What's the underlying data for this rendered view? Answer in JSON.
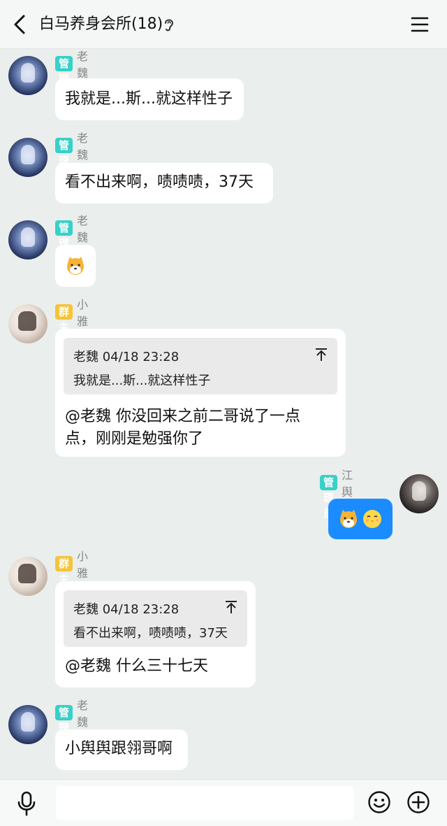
{
  "header": {
    "title": "白马养身会所(18)",
    "back_icon": "chevron-left-icon",
    "ear_icon": "ear-icon",
    "menu_icon": "menu-icon"
  },
  "badges": {
    "admin": "管理员",
    "owner": "群主"
  },
  "messages": [
    {
      "sender": "老魏",
      "role": "admin",
      "text": "我就是...斯...就这样性子"
    },
    {
      "sender": "老魏",
      "role": "admin",
      "text": "看不出来啊，啧啧啧，37天"
    },
    {
      "sender": "老魏",
      "role": "admin",
      "emoji": "shiba-dog-emoji"
    },
    {
      "sender": "小雅",
      "role": "owner",
      "quote": {
        "header": "老魏 04/18 23:28",
        "text": "我就是...斯...就这样性子"
      },
      "line1": "@老魏 你没回来之前二哥说了一点",
      "line2": "点，刚刚是勉强你了"
    },
    {
      "sender": "江舆",
      "role": "admin",
      "self": true,
      "emojis": [
        "shiba-dog-emoji",
        "chick-emoji"
      ]
    },
    {
      "sender": "小雅",
      "role": "owner",
      "quote": {
        "header": "老魏 04/18 23:28",
        "text": "看不出来啊，啧啧啧，37天"
      },
      "line1": "@老魏 什么三十七天"
    },
    {
      "sender": "老魏",
      "role": "admin",
      "text": "小舆舆跟翎哥啊"
    }
  ],
  "composer": {
    "placeholder": "",
    "mic_icon": "microphone-icon",
    "emoji_icon": "smiley-icon",
    "plus_icon": "plus-circle-icon"
  },
  "colors": {
    "admin_badge": "#38d0c8",
    "owner_badge": "#f5c437",
    "self_bubble": "#1a8cff",
    "background": "#eaeeec"
  }
}
